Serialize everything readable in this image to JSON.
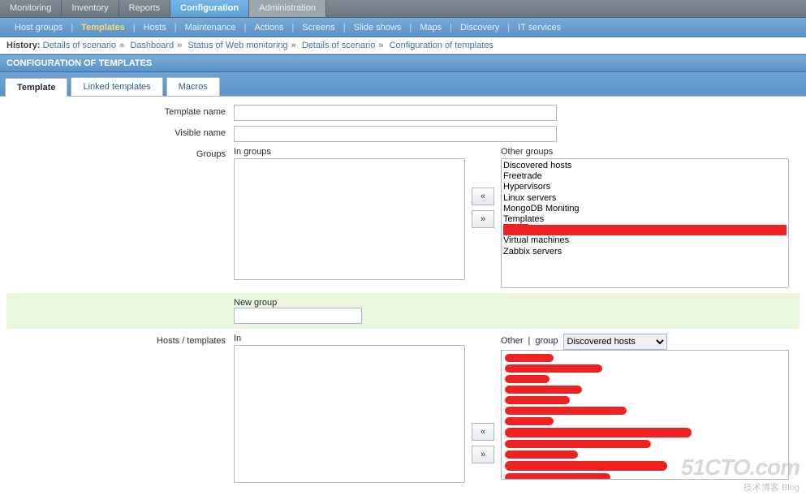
{
  "topnav": {
    "items": [
      "Monitoring",
      "Inventory",
      "Reports",
      "Configuration",
      "Administration"
    ],
    "active_index": 3
  },
  "subnav": {
    "items": [
      "Host groups",
      "Templates",
      "Hosts",
      "Maintenance",
      "Actions",
      "Screens",
      "Slide shows",
      "Maps",
      "Discovery",
      "IT services"
    ],
    "active_index": 1
  },
  "history": {
    "label": "History:",
    "crumbs": [
      "Details of scenario",
      "Dashboard",
      "Status of Web monitoring",
      "Details of scenario",
      "Configuration of templates"
    ]
  },
  "page_title": "CONFIGURATION OF TEMPLATES",
  "form_tabs": {
    "items": [
      "Template",
      "Linked templates",
      "Macros"
    ],
    "active_index": 0
  },
  "form": {
    "template_name_label": "Template name",
    "template_name_value": "",
    "visible_name_label": "Visible name",
    "visible_name_value": "",
    "groups_label": "Groups",
    "in_groups_caption": "In groups",
    "other_groups_caption": "Other groups",
    "other_groups": [
      "Discovered hosts",
      "Freetrade",
      "Hypervisors",
      "Linux servers",
      "MongoDB Moniting",
      "Templates",
      "███████",
      "Virtual machines",
      "Zabbix servers"
    ],
    "move_left_label": "«",
    "move_right_label": "»",
    "new_group_label": "New group",
    "new_group_value": "",
    "hosts_label": "Hosts / templates",
    "in_caption": "In",
    "other_caption": "Other",
    "group_caption": "group",
    "group_select_value": "Discovered hosts"
  },
  "watermark": {
    "big": "51CTO.com",
    "small1": "技术博客",
    "small2": "Blog"
  }
}
